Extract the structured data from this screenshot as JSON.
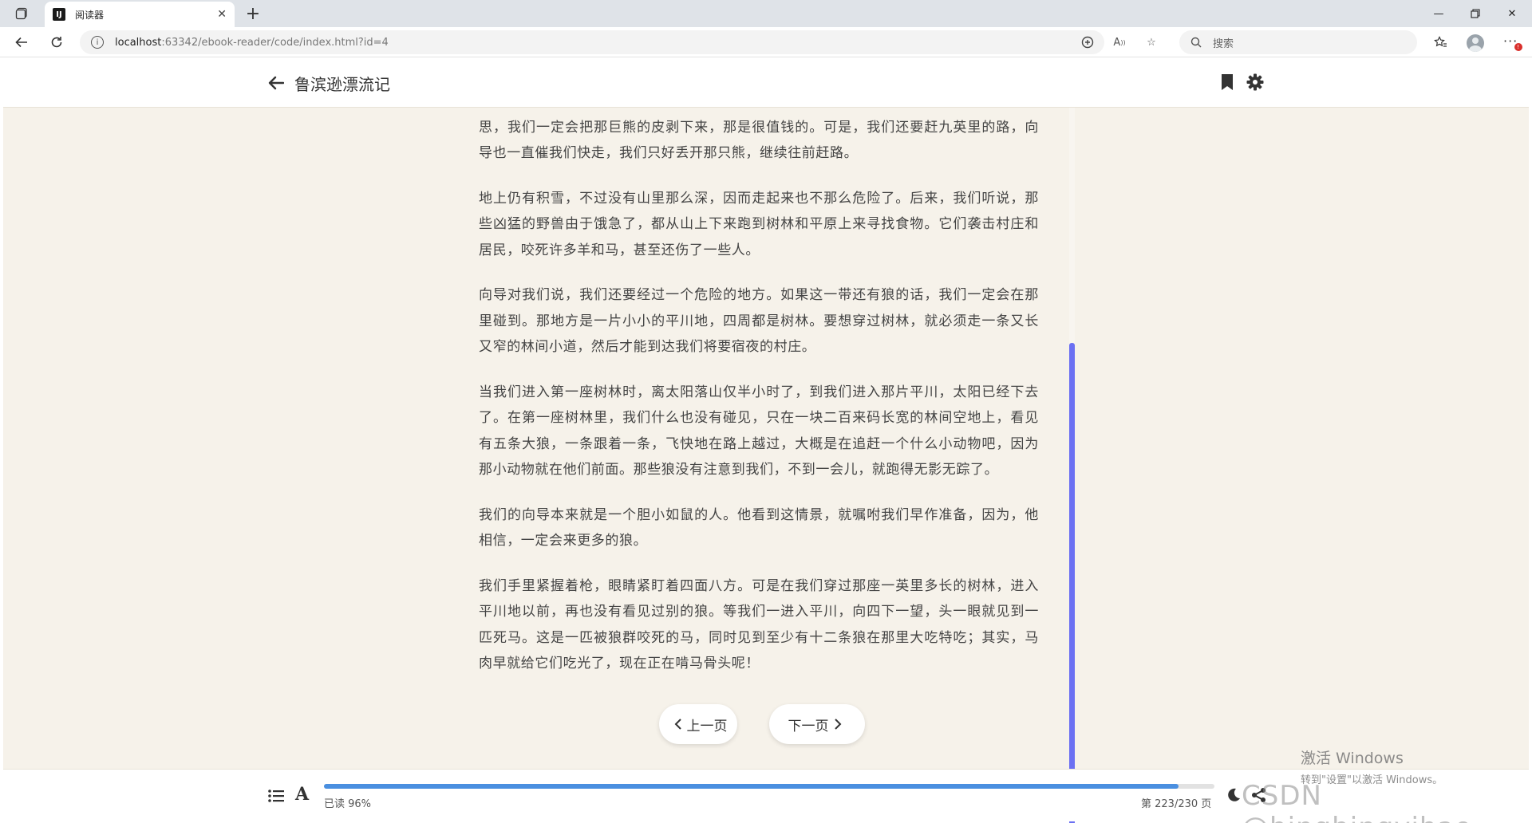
{
  "browser": {
    "tab_title": "阅读器",
    "tab_favicon": "IJ",
    "url_host": "localhost",
    "url_path": ":63342/ebook-reader/code/index.html?id=4",
    "search_placeholder": "搜索",
    "notification_badge": "!"
  },
  "reader": {
    "book_title": "鲁滨逊漂流记",
    "paragraphs": [
      "出了上述这些情况，向原还次仍是了，我们仍不得不赶为离开。不然的话，很是以这些恶思，我们一定会把那巨熊的皮剥下来，那是很值钱的。可是，我们还要赶九英里的路，向导也一直催我们快走，我们只好丢开那只熊，继续往前赶路。",
      "地上仍有积雪，不过没有山里那么深，因而走起来也不那么危险了。后来，我们听说，那些凶猛的野兽由于饿急了，都从山上下来跑到树林和平原上来寻找食物。它们袭击村庄和居民，咬死许多羊和马，甚至还伤了一些人。",
      "向导对我们说，我们还要经过一个危险的地方。如果这一带还有狼的话，我们一定会在那里碰到。那地方是一片小小的平川地，四周都是树林。要想穿过树林，就必须走一条又长又窄的林间小道，然后才能到达我们将要宿夜的村庄。",
      "当我们进入第一座树林时，离太阳落山仅半小时了，到我们进入那片平川，太阳已经下去了。在第一座树林里，我们什么也没有碰见，只在一块二百来码长宽的林间空地上，看见有五条大狼，一条跟着一条，飞快地在路上越过，大概是在追赶一个什么小动物吧，因为那小动物就在他们前面。那些狼没有注意到我们，不到一会儿，就跑得无影无踪了。",
      "我们的向导本来就是一个胆小如鼠的人。他看到这情景，就嘱咐我们早作准备，因为，他相信，一定会来更多的狼。",
      "我们手里紧握着枪，眼睛紧盯着四面八方。可是在我们穿过那座一英里多长的树林，进入平川地以前，再也没有看见过别的狼。等我们一进入平川，向四下一望，头一眼就见到一匹死马。这是一匹被狼群咬死的马，同时见到至少有十二条狼在那里大吃特吃；其实，马肉早就给它们吃光了，现在正在啃马骨头呢！"
    ],
    "prev_label": "上一页",
    "next_label": "下一页",
    "read_label": "已读 96%",
    "read_fraction": 0.96,
    "page_label": "第 223/230 页",
    "accent_color": "#6b70f2",
    "progress_color": "#4a8fe0",
    "background_color": "#f6f2ea"
  },
  "overlay": {
    "activate_title": "激活 Windows",
    "activate_sub": "转到\"设置\"以激活 Windows。",
    "watermark": "CSDN @bingbingyihao"
  }
}
